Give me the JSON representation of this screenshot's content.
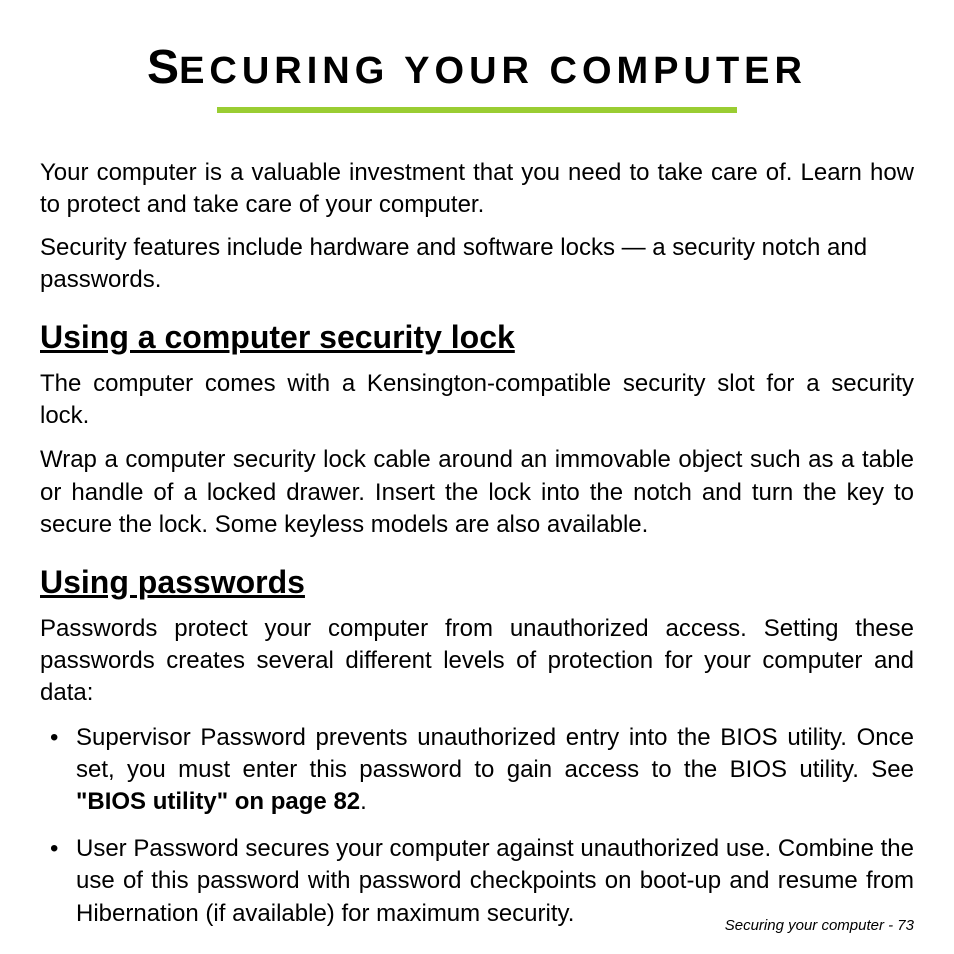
{
  "title_big": "S",
  "title_rest": "ECURING YOUR COMPUTER",
  "intro1": "Your computer is a valuable investment that you need to take care of. Learn how to protect and take care of your computer.",
  "intro2": "Security features include hardware and software locks — a security notch and passwords.",
  "section1": {
    "heading": "Using a computer security lock",
    "p1": "The computer comes with a Kensington-compatible security slot for a security lock.",
    "p2": "Wrap a computer security lock cable around an immovable object such as a table or handle of a locked drawer. Insert the lock into the notch and turn the key to secure the lock. Some keyless models are also available."
  },
  "section2": {
    "heading": "Using passwords",
    "p1": "Passwords protect your computer from unauthorized access. Setting these passwords creates several different levels of protection for your computer and data:",
    "bullets": [
      {
        "pre": "Supervisor Password prevents unauthorized entry into the BIOS utility. Once set, you must enter this password to gain access to the BIOS utility. See ",
        "bold": "\"BIOS utility\" on page 82",
        "post": "."
      },
      {
        "pre": "User Password secures your computer against unauthorized use. Combine the use of this password with password checkpoints on boot-up and resume from Hibernation (if available) for maximum security.",
        "bold": "",
        "post": ""
      }
    ]
  },
  "footer": "Securing your computer -  73"
}
